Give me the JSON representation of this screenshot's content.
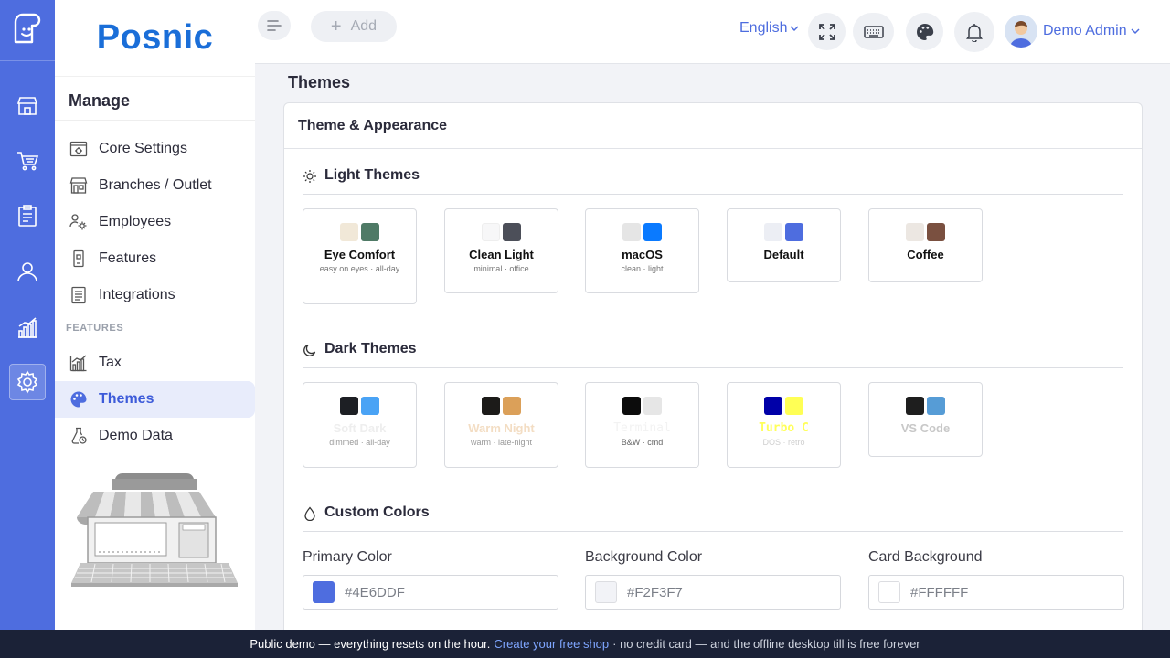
{
  "brand": {
    "name": "Posnic",
    "color": "#1a6ed8"
  },
  "rail": {
    "items": [
      {
        "icon": "store-icon"
      },
      {
        "icon": "cart-icon"
      },
      {
        "icon": "clipboard-icon"
      },
      {
        "icon": "user-icon"
      },
      {
        "icon": "chart-icon"
      },
      {
        "icon": "gear-icon",
        "active": true
      }
    ],
    "accent": "#4e6ddf"
  },
  "sidebar": {
    "title": "Manage",
    "items": [
      {
        "label": "Core Settings",
        "icon": "settings-window-icon"
      },
      {
        "label": "Branches / Outlet",
        "icon": "storefront-icon"
      },
      {
        "label": "Employees",
        "icon": "employees-gear-icon"
      },
      {
        "label": "Features",
        "icon": "device-icon"
      },
      {
        "label": "Integrations",
        "icon": "document-list-icon"
      }
    ],
    "section_label": "FEATURES",
    "feature_items": [
      {
        "label": "Tax",
        "icon": "tax-chart-icon"
      },
      {
        "label": "Themes",
        "icon": "palette-icon",
        "active": true
      },
      {
        "label": "Demo Data",
        "icon": "demo-data-icon"
      }
    ]
  },
  "topbar": {
    "add_label": "Add",
    "language": "English",
    "user_name": "Demo Admin",
    "icons": [
      "fullscreen-icon",
      "keyboard-icon",
      "palette-icon",
      "bell-icon"
    ]
  },
  "page": {
    "title": "Themes"
  },
  "card": {
    "title": "Theme & Appearance",
    "light_section": "Light Themes",
    "dark_section": "Dark Themes",
    "custom_section": "Custom Colors",
    "light_themes": [
      {
        "name": "Eye Comfort",
        "desc": "easy on eyes · all-day",
        "colors": [
          "#f1e8d8",
          "#4f7a66"
        ]
      },
      {
        "name": "Clean Light",
        "desc": "minimal · office",
        "colors": [
          "#f7f7f8",
          "#4c4f59"
        ]
      },
      {
        "name": "macOS",
        "desc": "clean · light",
        "colors": [
          "#e5e5e5",
          "#0a7aff"
        ]
      },
      {
        "name": "Default",
        "desc": "",
        "colors": [
          "#eceef4",
          "#4e6ddf"
        ]
      },
      {
        "name": "Coffee",
        "desc": "",
        "colors": [
          "#ece7e2",
          "#7a5040"
        ]
      }
    ],
    "dark_themes": [
      {
        "name": "Soft Dark",
        "desc": "dimmed · all-day",
        "colors": [
          "#1d1f24",
          "#4aa3f5"
        ]
      },
      {
        "name": "Warm Night",
        "desc": "warm · late-night",
        "colors": [
          "#1c1b19",
          "#dba059"
        ]
      },
      {
        "name": "Terminal",
        "desc": "B&W · cmd",
        "colors": [
          "#0c0c0c",
          "#e6e6e6"
        ]
      },
      {
        "name": "Turbo C",
        "desc": "DOS · retro",
        "colors": [
          "#0000a8",
          "#ffff55"
        ]
      },
      {
        "name": "VS Code",
        "desc": "",
        "colors": [
          "#1e1e1e",
          "#569cd6"
        ]
      }
    ],
    "custom_colors": [
      {
        "label": "Primary Color",
        "value": "#4E6DDF"
      },
      {
        "label": "Background Color",
        "value": "#F2F3F7"
      },
      {
        "label": "Card Background",
        "value": "#FFFFFF"
      }
    ]
  },
  "banner": {
    "text_before": "Public demo — everything resets on the hour.",
    "link": "Create your free shop",
    "text_after": "· no credit card — and the offline desktop till is free forever"
  }
}
